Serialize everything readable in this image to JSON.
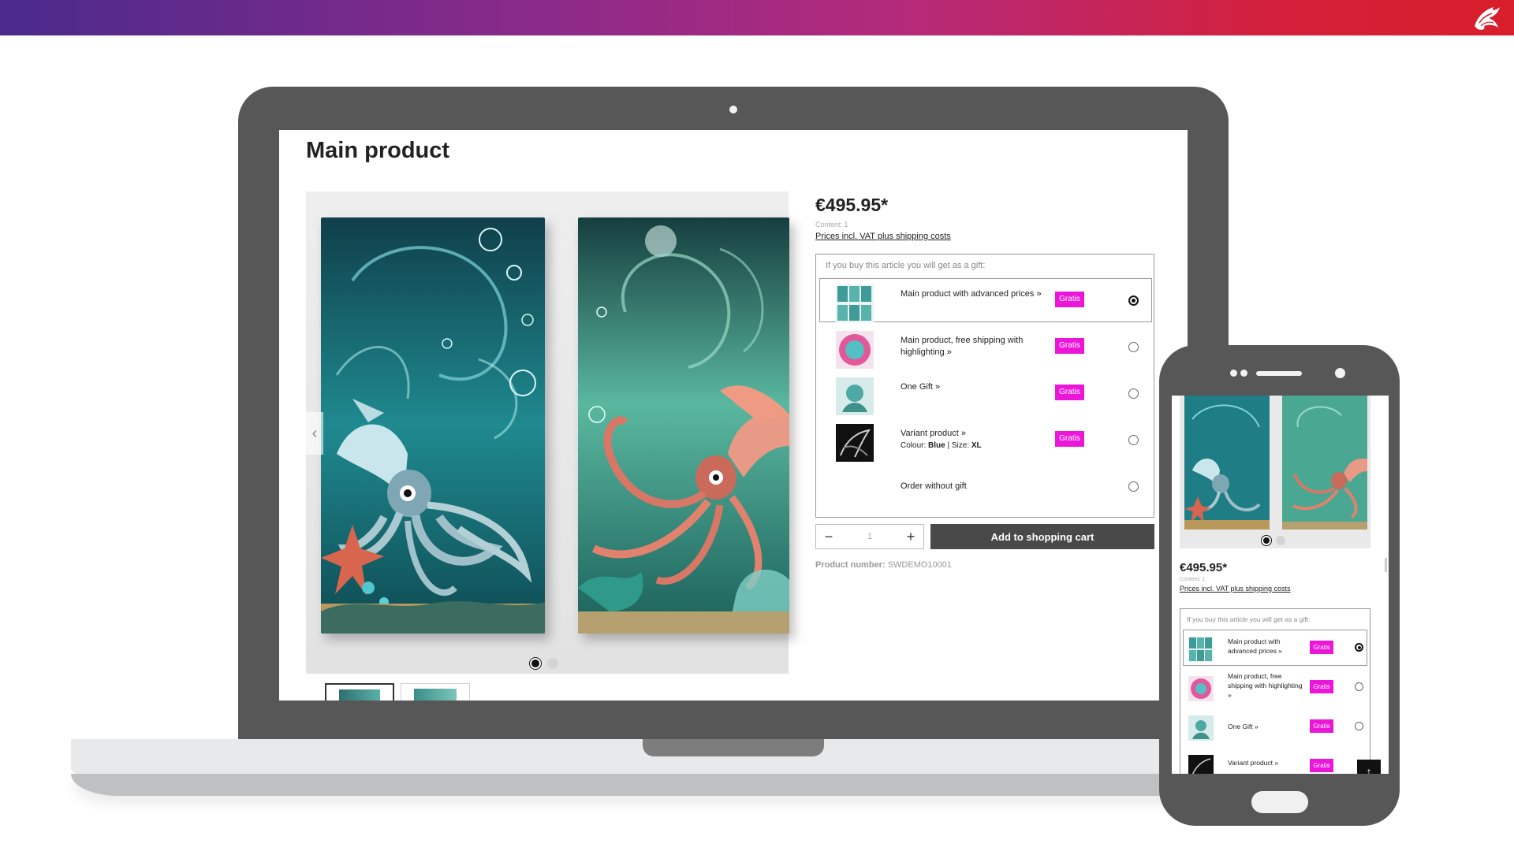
{
  "colors": {
    "gratis_badge": "#ec16d8",
    "cart_button": "#494949",
    "device_frame": "#575757"
  },
  "header": {
    "logo_icon": "dragon-logo-icon"
  },
  "desktop": {
    "page_title": "Main product",
    "gallery": {
      "prev_label": "‹",
      "prev_icon": "chevron-left-icon",
      "slides": 2,
      "active_slide": 1
    },
    "buybox": {
      "price": "€495.95*",
      "content": "Content: 1",
      "vat_link": "Prices incl. VAT plus shipping costs",
      "gift_heading": "If you buy this article you will get as a gift:",
      "gifts": [
        {
          "name": "Main product with advanced prices",
          "arrow": "»",
          "badge": "Gratis",
          "selected": true
        },
        {
          "name": "Main product, free shipping with highlighting",
          "arrow": "»",
          "badge": "Gratis",
          "selected": false
        },
        {
          "name": "One Gift",
          "arrow": "»",
          "badge": "Gratis",
          "selected": false
        },
        {
          "name": "Variant product",
          "arrow": "»",
          "badge": "Gratis",
          "selected": false,
          "colour_label": "Colour:",
          "colour_value": "Blue",
          "size_label": "Size:",
          "size_value": "XL"
        },
        {
          "name": "Order without gift",
          "selected": false
        }
      ],
      "quantity": {
        "minus": "−",
        "plus": "+",
        "value": "1"
      },
      "add_to_cart": "Add to shopping cart",
      "product_number_label": "Product number:",
      "product_number": "SWDEMO10001"
    }
  },
  "mobile": {
    "price": "€495.95*",
    "content": "Content: 1",
    "vat_link": "Prices incl. VAT plus shipping costs",
    "gift_heading": "If you buy this article you will get as a gift:",
    "gifts": [
      {
        "name": "Main product with advanced prices",
        "arrow": "»",
        "badge": "Gratis",
        "selected": true
      },
      {
        "name": "Main product, free shipping with highlighting",
        "arrow": "»",
        "badge": "Gratis",
        "selected": false
      },
      {
        "name": "One Gift",
        "arrow": "»",
        "badge": "Gratis",
        "selected": false
      },
      {
        "name": "Variant product",
        "arrow": "»",
        "badge": "Gratis",
        "selected": false
      }
    ],
    "scroll_top_label": "↑"
  }
}
